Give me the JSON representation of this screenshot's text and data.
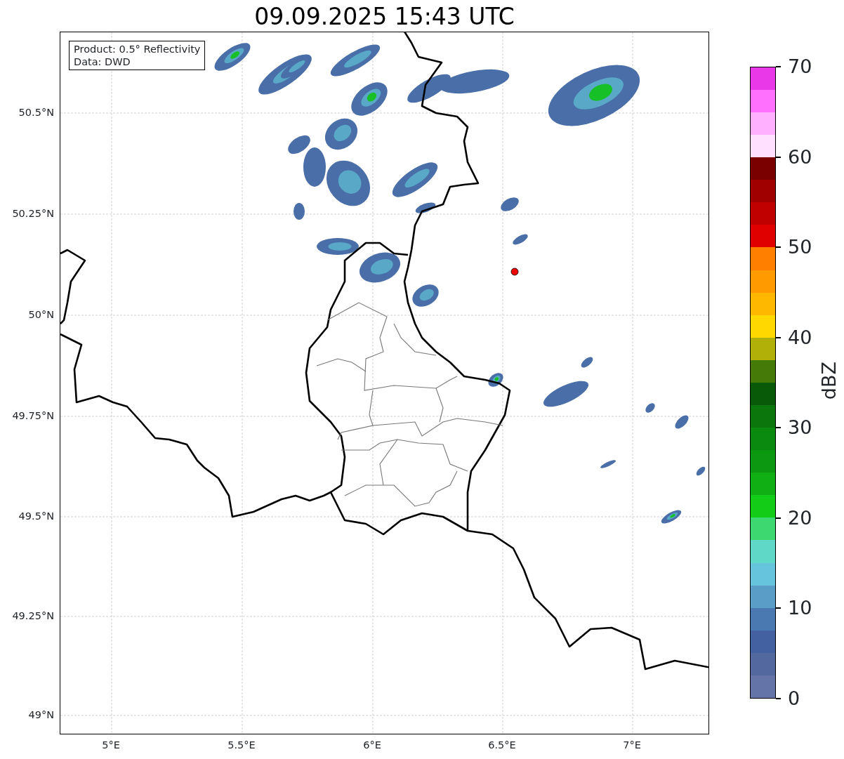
{
  "title": "09.09.2025 15:43 UTC",
  "info_box": {
    "lines": [
      "Product: 0.5° Reflectivity",
      "Data: DWD"
    ]
  },
  "y_axis": {
    "ticks": [
      "50.5°N",
      "50.25°N",
      "50°N",
      "49.75°N",
      "49.5°N",
      "49.25°N",
      "49°N"
    ]
  },
  "x_axis": {
    "ticks": [
      "5°E",
      "5.5°E",
      "6°E",
      "6.5°E",
      "7°E"
    ]
  },
  "colorbar": {
    "label": "dBZ",
    "ticks": [
      "70",
      "60",
      "50",
      "40",
      "30",
      "20",
      "10",
      "0"
    ],
    "bands": [
      {
        "color": "#6474a8"
      },
      {
        "color": "#5468a0"
      },
      {
        "color": "#4360a0"
      },
      {
        "color": "#4a78b0"
      },
      {
        "color": "#5a9ec8"
      },
      {
        "color": "#66c4dc"
      },
      {
        "color": "#60d8c8"
      },
      {
        "color": "#3ed870"
      },
      {
        "color": "#12cc18"
      },
      {
        "color": "#10b014"
      },
      {
        "color": "#0c9810"
      },
      {
        "color": "#0a8a0e"
      },
      {
        "color": "#0a760c"
      },
      {
        "color": "#085a08"
      },
      {
        "color": "#467a08"
      },
      {
        "color": "#b0b008"
      },
      {
        "color": "#ffd800"
      },
      {
        "color": "#ffb800"
      },
      {
        "color": "#ff9a00"
      },
      {
        "color": "#ff8000"
      },
      {
        "color": "#e00000"
      },
      {
        "color": "#c00000"
      },
      {
        "color": "#a00000"
      },
      {
        "color": "#7a0000"
      },
      {
        "color": "#ffe0ff"
      },
      {
        "color": "#ffb0ff"
      },
      {
        "color": "#ff70ff"
      },
      {
        "color": "#e838e8"
      }
    ]
  }
}
